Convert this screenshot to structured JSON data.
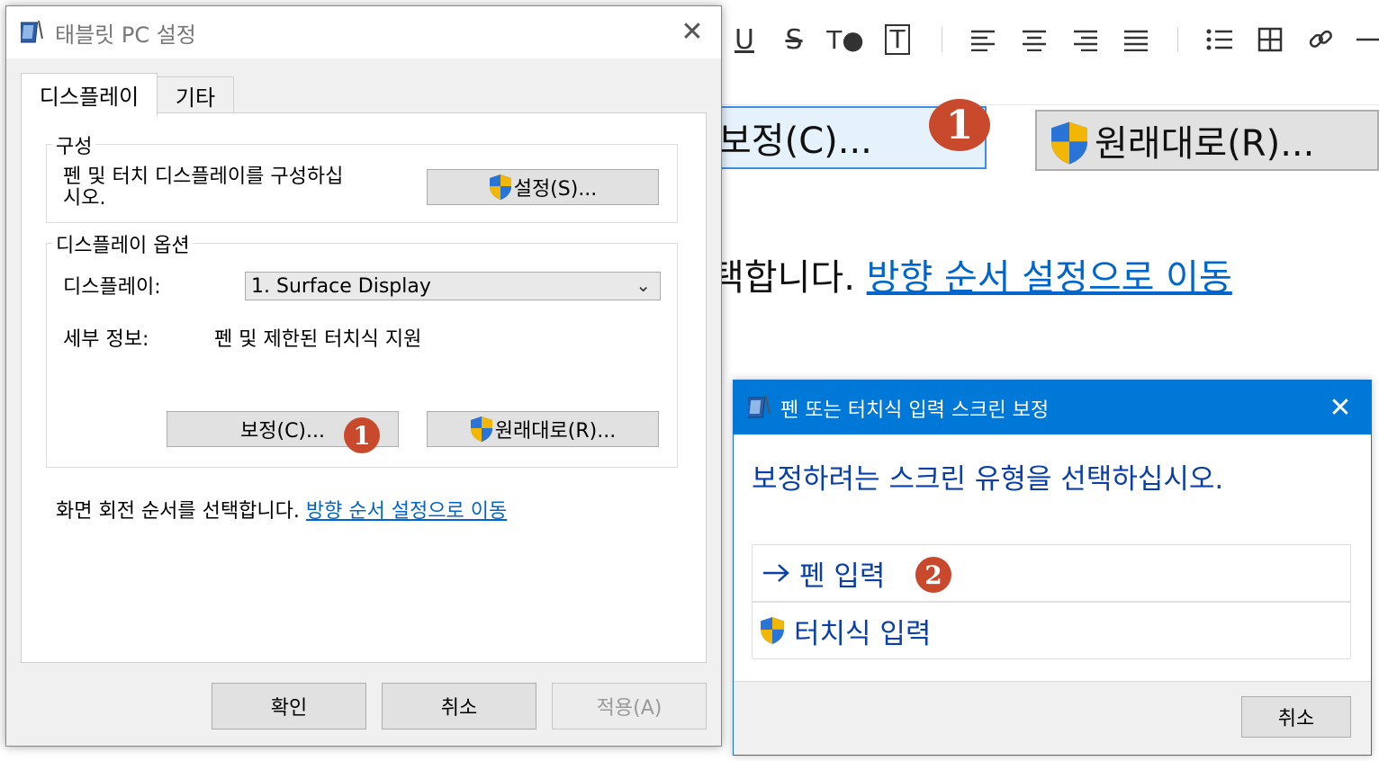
{
  "background": {
    "toolbar": {
      "underline": "U",
      "strike": "S",
      "text_color": "T●",
      "text_box": "T"
    },
    "calibrate_button": "보정(C)...",
    "badge_1": "1",
    "restore_button": "원래대로(R)...",
    "rotation_text_fragment": "택합니다. ",
    "rotation_link": "방향 순서 설정으로 이동"
  },
  "tablet_dialog": {
    "title": "태블릿 PC 설정",
    "close": "✕",
    "tabs": [
      "디스플레이",
      "기타"
    ],
    "config_group": {
      "label": "구성",
      "description_line1": "펜 및 터치 디스플레이를 구성하십",
      "description_line2": "시오.",
      "setup_button": "설정(S)..."
    },
    "display_options_group": {
      "label": "디스플레이 옵션",
      "display_label": "디스플레이:",
      "display_value": "1. Surface Display",
      "details_label": "세부 정보:",
      "details_value": "펜 및 제한된 터치식 지원",
      "calibrate_button": "보정(C)...",
      "badge_1": "1",
      "restore_button": "원래대로(R)..."
    },
    "rotation_text": "화면 회전 순서를 선택합니다.",
    "rotation_link": "방향 순서 설정으로 이동",
    "ok_button": "확인",
    "cancel_button": "취소",
    "apply_button": "적용(A)"
  },
  "calibrate_dialog": {
    "title": "펜 또는 터치식 입력 스크린 보정",
    "close": "✕",
    "prompt": "보정하려는 스크린 유형을 선택하십시오.",
    "options": [
      {
        "label": "펜 입력",
        "icon": "arrow-right-icon"
      },
      {
        "label": "터치식 입력",
        "icon": "uac-shield-icon"
      }
    ],
    "badge_2": "2",
    "cancel_button": "취소"
  },
  "colors": {
    "accent": "#0078d7",
    "badge": "#c8492c",
    "link": "#0066cc"
  }
}
